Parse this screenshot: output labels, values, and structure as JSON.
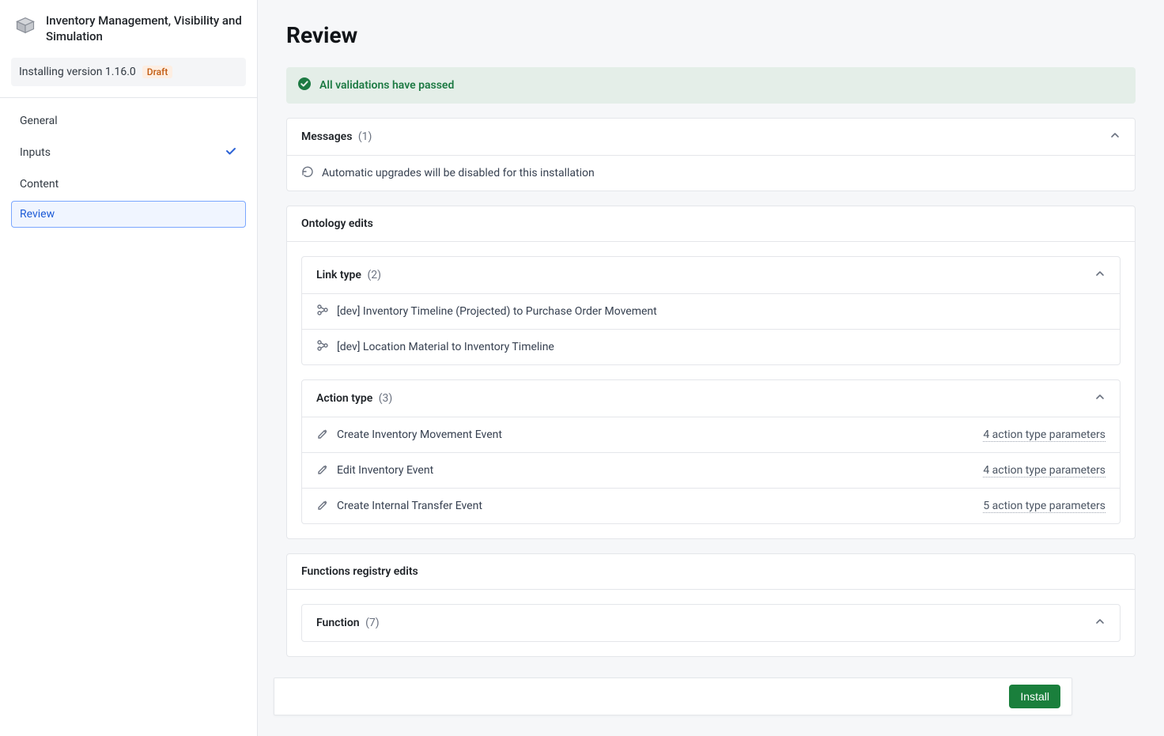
{
  "sidebar": {
    "title": "Inventory Management, Visibility and Simulation",
    "version_line": "Installing version 1.16.0",
    "draft_badge": "Draft",
    "nav": {
      "general": "General",
      "inputs": "Inputs",
      "content": "Content",
      "review": "Review"
    }
  },
  "page": {
    "title": "Review",
    "validation_pass": "All validations have passed"
  },
  "messages": {
    "title": "Messages",
    "count": "(1)",
    "items": [
      "Automatic upgrades will be disabled for this installation"
    ]
  },
  "ontology": {
    "title": "Ontology edits",
    "link_type": {
      "title": "Link type",
      "count": "(2)",
      "items": [
        "[dev] Inventory Timeline (Projected) to Purchase Order Movement",
        "[dev] Location Material to Inventory Timeline"
      ]
    },
    "action_type": {
      "title": "Action type",
      "count": "(3)",
      "items": [
        {
          "name": "Create Inventory Movement Event",
          "params": "4 action type parameters"
        },
        {
          "name": "Edit Inventory Event",
          "params": "4 action type parameters"
        },
        {
          "name": "Create Internal Transfer Event",
          "params": "5 action type parameters"
        }
      ]
    }
  },
  "functions": {
    "title": "Functions registry edits",
    "function": {
      "title": "Function",
      "count": "(7)"
    }
  },
  "footer": {
    "install": "Install"
  }
}
